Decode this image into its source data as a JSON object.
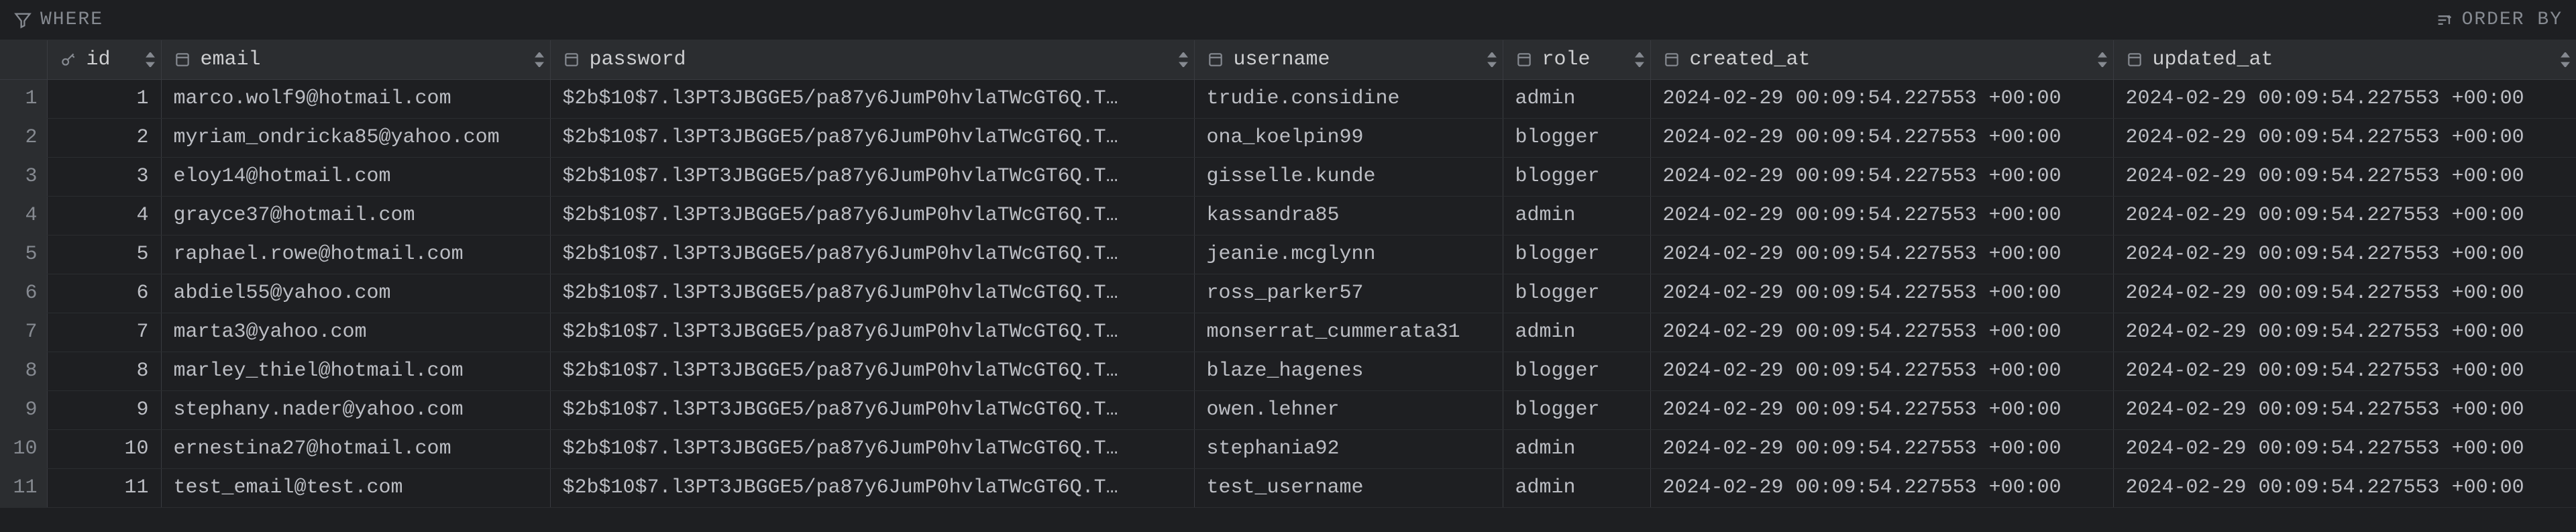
{
  "filterBar": {
    "whereLabel": "WHERE",
    "orderByLabel": "ORDER BY"
  },
  "columns": {
    "id": "id",
    "email": "email",
    "password": "password",
    "username": "username",
    "role": "role",
    "created_at": "created_at",
    "updated_at": "updated_at"
  },
  "rows": [
    {
      "num": "1",
      "id": "1",
      "email": "marco.wolf9@hotmail.com",
      "password": "$2b$10$7.l3PT3JBGGE5/pa87y6JumP0hvlaTWcGT6Q.T…",
      "username": "trudie.considine",
      "role": "admin",
      "created_at": "2024-02-29 00:09:54.227553 +00:00",
      "updated_at": "2024-02-29 00:09:54.227553 +00:00"
    },
    {
      "num": "2",
      "id": "2",
      "email": "myriam_ondricka85@yahoo.com",
      "password": "$2b$10$7.l3PT3JBGGE5/pa87y6JumP0hvlaTWcGT6Q.T…",
      "username": "ona_koelpin99",
      "role": "blogger",
      "created_at": "2024-02-29 00:09:54.227553 +00:00",
      "updated_at": "2024-02-29 00:09:54.227553 +00:00"
    },
    {
      "num": "3",
      "id": "3",
      "email": "eloy14@hotmail.com",
      "password": "$2b$10$7.l3PT3JBGGE5/pa87y6JumP0hvlaTWcGT6Q.T…",
      "username": "gisselle.kunde",
      "role": "blogger",
      "created_at": "2024-02-29 00:09:54.227553 +00:00",
      "updated_at": "2024-02-29 00:09:54.227553 +00:00"
    },
    {
      "num": "4",
      "id": "4",
      "email": "grayce37@hotmail.com",
      "password": "$2b$10$7.l3PT3JBGGE5/pa87y6JumP0hvlaTWcGT6Q.T…",
      "username": "kassandra85",
      "role": "admin",
      "created_at": "2024-02-29 00:09:54.227553 +00:00",
      "updated_at": "2024-02-29 00:09:54.227553 +00:00"
    },
    {
      "num": "5",
      "id": "5",
      "email": "raphael.rowe@hotmail.com",
      "password": "$2b$10$7.l3PT3JBGGE5/pa87y6JumP0hvlaTWcGT6Q.T…",
      "username": "jeanie.mcglynn",
      "role": "blogger",
      "created_at": "2024-02-29 00:09:54.227553 +00:00",
      "updated_at": "2024-02-29 00:09:54.227553 +00:00"
    },
    {
      "num": "6",
      "id": "6",
      "email": "abdiel55@yahoo.com",
      "password": "$2b$10$7.l3PT3JBGGE5/pa87y6JumP0hvlaTWcGT6Q.T…",
      "username": "ross_parker57",
      "role": "blogger",
      "created_at": "2024-02-29 00:09:54.227553 +00:00",
      "updated_at": "2024-02-29 00:09:54.227553 +00:00"
    },
    {
      "num": "7",
      "id": "7",
      "email": "marta3@yahoo.com",
      "password": "$2b$10$7.l3PT3JBGGE5/pa87y6JumP0hvlaTWcGT6Q.T…",
      "username": "monserrat_cummerata31",
      "role": "admin",
      "created_at": "2024-02-29 00:09:54.227553 +00:00",
      "updated_at": "2024-02-29 00:09:54.227553 +00:00"
    },
    {
      "num": "8",
      "id": "8",
      "email": "marley_thiel@hotmail.com",
      "password": "$2b$10$7.l3PT3JBGGE5/pa87y6JumP0hvlaTWcGT6Q.T…",
      "username": "blaze_hagenes",
      "role": "blogger",
      "created_at": "2024-02-29 00:09:54.227553 +00:00",
      "updated_at": "2024-02-29 00:09:54.227553 +00:00"
    },
    {
      "num": "9",
      "id": "9",
      "email": "stephany.nader@yahoo.com",
      "password": "$2b$10$7.l3PT3JBGGE5/pa87y6JumP0hvlaTWcGT6Q.T…",
      "username": "owen.lehner",
      "role": "blogger",
      "created_at": "2024-02-29 00:09:54.227553 +00:00",
      "updated_at": "2024-02-29 00:09:54.227553 +00:00"
    },
    {
      "num": "10",
      "id": "10",
      "email": "ernestina27@hotmail.com",
      "password": "$2b$10$7.l3PT3JBGGE5/pa87y6JumP0hvlaTWcGT6Q.T…",
      "username": "stephania92",
      "role": "admin",
      "created_at": "2024-02-29 00:09:54.227553 +00:00",
      "updated_at": "2024-02-29 00:09:54.227553 +00:00"
    },
    {
      "num": "11",
      "id": "11",
      "email": "test_email@test.com",
      "password": "$2b$10$7.l3PT3JBGGE5/pa87y6JumP0hvlaTWcGT6Q.T…",
      "username": "test_username",
      "role": "admin",
      "created_at": "2024-02-29 00:09:54.227553 +00:00",
      "updated_at": "2024-02-29 00:09:54.227553 +00:00"
    }
  ]
}
